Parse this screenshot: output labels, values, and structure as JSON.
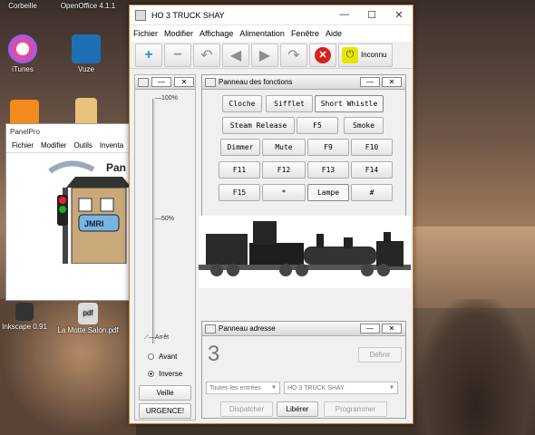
{
  "desktop": {
    "icons": [
      {
        "label": "Corbeille"
      },
      {
        "label": "OpenOffice 4.1.1"
      },
      {
        "label": "iTunes"
      },
      {
        "label": "Vuze"
      },
      {
        "label": "Inkscape 0.91"
      },
      {
        "label": "La Motte Salon.pdf"
      }
    ]
  },
  "panelpro": {
    "title": "PanelPro",
    "menu": [
      "Fichier",
      "Modifier",
      "Outils",
      "Inventa"
    ],
    "logo_text": "JMRI",
    "side_text": "Pan"
  },
  "window": {
    "title": "HO 3 TRUCK SHAY",
    "controls": {
      "minimize": "—",
      "maximize": "☐",
      "close": "✕"
    }
  },
  "menubar": [
    "Fichier",
    "Modifier",
    "Affichage",
    "Alimentation",
    "Fenêtre",
    "Aide"
  ],
  "toolbar": {
    "power_label": "Inconnu"
  },
  "throttle": {
    "tick_top": "100%",
    "tick_mid": "50%",
    "tick_bottom": "Arrêt",
    "speed_value": 0,
    "direction": {
      "forward": "Avant",
      "reverse": "Inverse",
      "selected": "Inverse"
    },
    "idle_button": "Veille",
    "emergency_button": "URGENCE!"
  },
  "functions": {
    "title": "Panneau des fonctions",
    "buttons": [
      {
        "label": "Cloche"
      },
      {
        "label": "Sifflet"
      },
      {
        "label": "Short Whistle"
      },
      {
        "label": "Steam Release"
      },
      {
        "label": "F5"
      },
      {
        "label": "Smoke"
      },
      {
        "label": "Dimmer"
      },
      {
        "label": "Mute"
      },
      {
        "label": "F9"
      },
      {
        "label": "F10"
      },
      {
        "label": "F11"
      },
      {
        "label": "F12"
      },
      {
        "label": "F13"
      },
      {
        "label": "F14"
      },
      {
        "label": "F15"
      },
      {
        "label": "*"
      },
      {
        "label": "Lampe"
      },
      {
        "label": "#"
      }
    ]
  },
  "address": {
    "title": "Panneau adresse",
    "value": "3",
    "define_button": "Définir",
    "roster_filter": "Toutes les entrées",
    "roster_entry": "HO 3 TRUCK SHAY",
    "dispatch_button": "Dispatcher",
    "release_button": "Libérer",
    "program_button": "Programmer"
  },
  "colors": {
    "accent": "#3a8fd6",
    "stop": "#d62222",
    "power": "#e6e600",
    "frame_border": "#c8863a"
  }
}
